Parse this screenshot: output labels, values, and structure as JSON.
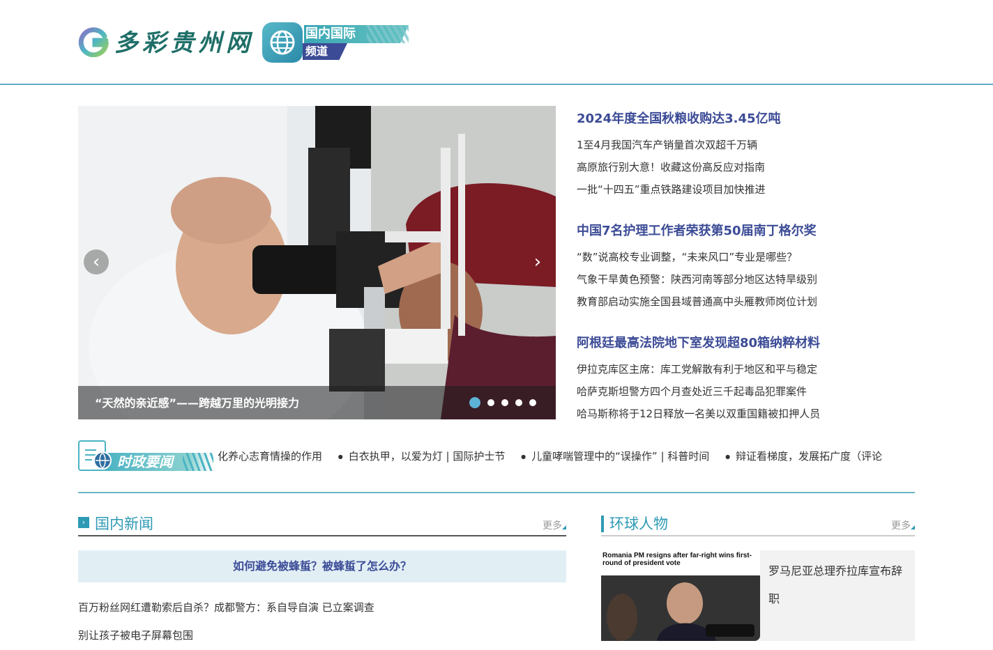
{
  "header": {
    "logo_text": "多彩贵州网",
    "channel_title": "国内国际",
    "channel_sub": "频道"
  },
  "slider": {
    "caption": "“天然的亲近感”——跨越万里的光明接力",
    "prev_icon": "chevron-left-icon",
    "next_icon": "chevron-right-icon",
    "dot_count": 5,
    "active_dot": 1
  },
  "news_groups": [
    {
      "headline": "2024年度全国秋粮收购达3.45亿吨",
      "items": [
        "1至4月我国汽车产销量首次双超千万辆",
        "高原旅行别大意！收藏这份高反应对指南",
        "一批“十四五”重点铁路建设项目加快推进"
      ]
    },
    {
      "headline": "中国7名护理工作者荣获第50届南丁格尔奖",
      "items": [
        "“数”说高校专业调整，“未来风口”专业是哪些？",
        "气象干旱黄色预警：陕西河南等部分地区达特旱级别",
        "教育部启动实施全国县域普通高中头雁教师岗位计划"
      ]
    },
    {
      "headline": "阿根廷最高法院地下室发现超80箱纳粹材料",
      "items": [
        "伊拉克库区主席：库工党解散有利于地区和平与稳定",
        "哈萨克斯坦警方四个月查处近三千起毒品犯罪案件",
        "哈马斯称将于12日释放一名美以双重国籍被扣押人员"
      ]
    }
  ],
  "ticker": {
    "label": "时政要闻",
    "items": [
      "化养心志育情操的作用",
      "白衣执甲，以爱为灯 | 国际护士节",
      "儿童哮喘管理中的“误操作” | 科普时间",
      "辩证看梯度，发展拓广度（评论"
    ]
  },
  "domestic": {
    "title": "国内新闻",
    "more": "更多",
    "feature": "如何避免被蜂蜇？被蜂蜇了怎么办？",
    "items": [
      "百万粉丝网红遭勒索后自杀？成都警方：系自导自演 已立案调查",
      "别让孩子被电子屏幕包围"
    ]
  },
  "global": {
    "title": "环球人物",
    "more": "更多",
    "card_image_headline": "Romania PM resigns after far-right wins first-round of president vote",
    "card_text": "罗马尼亚总理乔拉库宣布辞职"
  },
  "colors": {
    "accent": "#2e9ab4",
    "headline": "#3c4b96",
    "line": "#5fa8c9"
  }
}
